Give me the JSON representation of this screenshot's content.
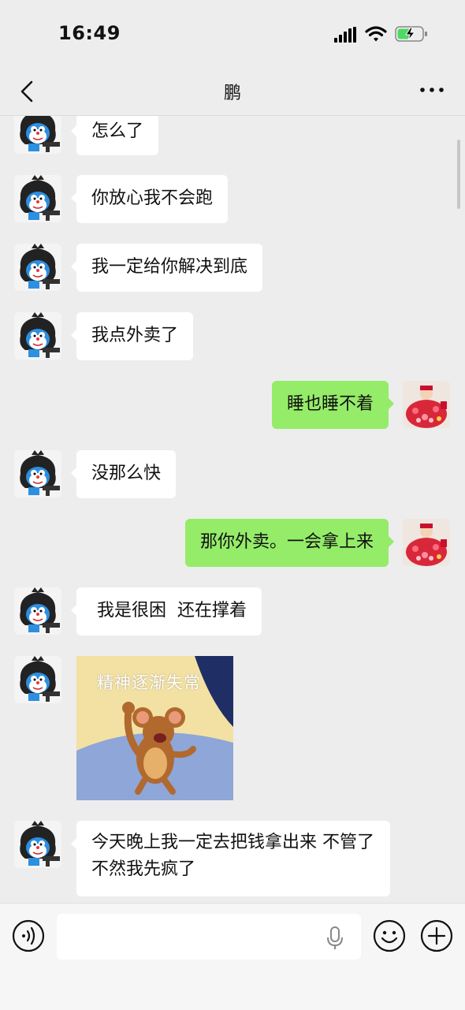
{
  "status_bar": {
    "time": "16:49"
  },
  "header": {
    "title": "鹏"
  },
  "messages": [
    {
      "side": "left",
      "type": "text",
      "text": "怎么了"
    },
    {
      "side": "left",
      "type": "text",
      "text": "你放心我不会跑"
    },
    {
      "side": "left",
      "type": "text",
      "text": "我一定给你解决到底"
    },
    {
      "side": "left",
      "type": "text",
      "text": "我点外卖了"
    },
    {
      "side": "right",
      "type": "text",
      "text": "睡也睡不着"
    },
    {
      "side": "left",
      "type": "text",
      "text": "没那么快"
    },
    {
      "side": "right",
      "type": "text",
      "text": "那你外卖。一会拿上来"
    },
    {
      "side": "left",
      "type": "text",
      "text": " 我是很困  还在撑着"
    },
    {
      "side": "left",
      "type": "sticker",
      "caption": "精神逐渐失常"
    },
    {
      "side": "left",
      "type": "text",
      "text": "今天晚上我一定去把钱拿出来 不管了 不然我先疯了"
    }
  ],
  "input_bar": {
    "draft": ""
  },
  "colors": {
    "background": "#ededed",
    "outgoing_bubble": "#95ec69",
    "incoming_bubble": "#ffffff"
  },
  "icons": [
    "signal-icon",
    "wifi-icon",
    "battery-charging-icon",
    "back-icon",
    "more-icon",
    "voice-icon",
    "mic-icon",
    "emoji-icon",
    "plus-icon"
  ]
}
